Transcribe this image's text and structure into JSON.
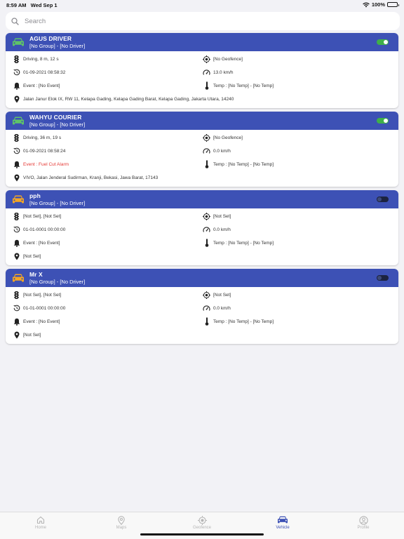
{
  "status_bar": {
    "time": "8:59 AM",
    "date": "Wed Sep 1",
    "battery": "100%"
  },
  "search": {
    "placeholder": "Search",
    "value": ""
  },
  "colors": {
    "header": "#3d51b5",
    "car_active": "#5fc468",
    "car_inactive": "#f5a623",
    "toggle_on": "#3fb049",
    "alarm": "#e53935"
  },
  "vehicles": [
    {
      "name": "AGUS DRIVER",
      "group": "[No Group] - [No Driver]",
      "status": "on",
      "car_color": "#5fc468",
      "state": "Driving, 8 m, 12 s",
      "geofence": "[No Geofence]",
      "datetime": "01-09-2021 08:58:32",
      "speed": "13.0 km/h",
      "event": "Event : [No Event]",
      "event_alarm": false,
      "temp": "Temp : [No Temp] - [No Temp]",
      "address": "Jalan Janur Elok IX, RW 11, Kelapa Gading, Kelapa Gading Barat, Kelapa Gading, Jakarta Utara, 14240"
    },
    {
      "name": "WAHYU COURIER",
      "group": "[No Group] - [No Driver]",
      "status": "on",
      "car_color": "#5fc468",
      "state": "Driving, 36 m, 19 s",
      "geofence": "[No Geofence]",
      "datetime": "01-09-2021 08:58:24",
      "speed": "0.0 km/h",
      "event": "Event : Fuel Cut Alarm",
      "event_alarm": true,
      "temp": "Temp : [No Temp] - [No Temp]",
      "address": "VIVO, Jalan Jenderal Sudirman, Kranji, Bekasi, Jawa Barat, 17143"
    },
    {
      "name": "pph",
      "group": "[No Group] - [No Driver]",
      "status": "off",
      "car_color": "#f5a623",
      "state": "[Not Set], [Not Set]",
      "geofence": "[Not Set]",
      "datetime": "01-01-0001 00:00:00",
      "speed": "0.0 km/h",
      "event": "Event : [No Event]",
      "event_alarm": false,
      "temp": "Temp : [No Temp] - [No Temp]",
      "address": "[Not Set]"
    },
    {
      "name": "Mr X",
      "group": "[No Group] - [No Driver]",
      "status": "off",
      "car_color": "#f5a623",
      "state": "[Not Set], [Not Set]",
      "geofence": "[Not Set]",
      "datetime": "01-01-0001 00:00:00",
      "speed": "0.0 km/h",
      "event": "Event : [No Event]",
      "event_alarm": false,
      "temp": "Temp : [No Temp] - [No Temp]",
      "address": "[Not Set]"
    }
  ],
  "tabs": [
    {
      "label": "Home",
      "icon": "home-icon",
      "active": false
    },
    {
      "label": "Maps",
      "icon": "map-pin-icon",
      "active": false
    },
    {
      "label": "Geofence",
      "icon": "geofence-icon",
      "active": false
    },
    {
      "label": "Vehicle",
      "icon": "car-icon",
      "active": true
    },
    {
      "label": "Profile",
      "icon": "profile-icon",
      "active": false
    }
  ]
}
